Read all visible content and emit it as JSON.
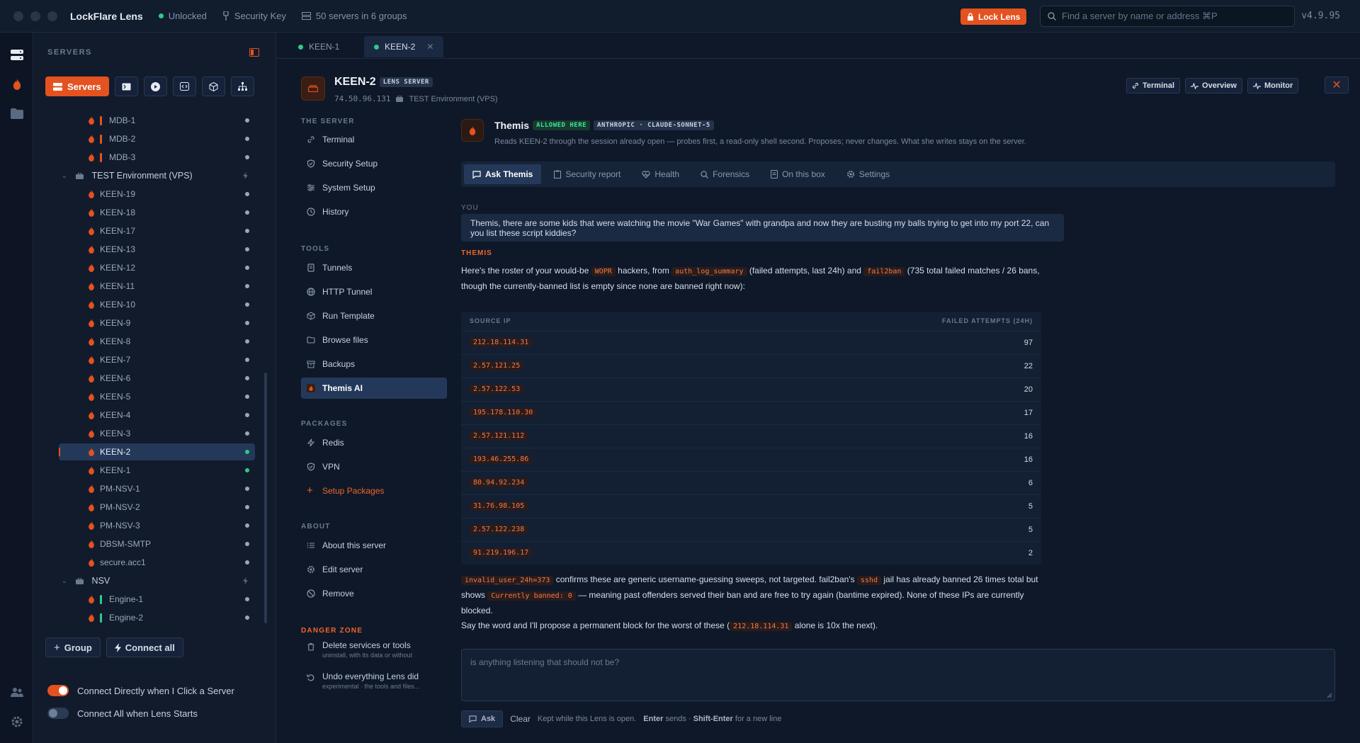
{
  "app": {
    "name": "LockFlare Lens",
    "status": "Unlocked",
    "key_label": "Security Key",
    "servers_summary": "50 servers in 6 groups",
    "lock_label": "Lock Lens",
    "search_placeholder": "Find a server by name or address ⌘P",
    "version": "v4.9.95"
  },
  "sidebar": {
    "heading": "SERVERS",
    "servers_button": "Servers",
    "tree": [
      {
        "name": "MDB-1",
        "kind": "server",
        "bar": "#e4521f"
      },
      {
        "name": "MDB-2",
        "kind": "server",
        "bar": "#e4521f"
      },
      {
        "name": "MDB-3",
        "kind": "server",
        "bar": "#e4521f"
      },
      {
        "name": "TEST Environment (VPS)",
        "kind": "group"
      },
      {
        "name": "KEEN-19",
        "kind": "server"
      },
      {
        "name": "KEEN-18",
        "kind": "server"
      },
      {
        "name": "KEEN-17",
        "kind": "server"
      },
      {
        "name": "KEEN-13",
        "kind": "server"
      },
      {
        "name": "KEEN-12",
        "kind": "server"
      },
      {
        "name": "KEEN-11",
        "kind": "server"
      },
      {
        "name": "KEEN-10",
        "kind": "server"
      },
      {
        "name": "KEEN-9",
        "kind": "server"
      },
      {
        "name": "KEEN-8",
        "kind": "server"
      },
      {
        "name": "KEEN-7",
        "kind": "server"
      },
      {
        "name": "KEEN-6",
        "kind": "server"
      },
      {
        "name": "KEEN-5",
        "kind": "server"
      },
      {
        "name": "KEEN-4",
        "kind": "server"
      },
      {
        "name": "KEEN-3",
        "kind": "server"
      },
      {
        "name": "KEEN-2",
        "kind": "server",
        "selected": true,
        "online": true
      },
      {
        "name": "KEEN-1",
        "kind": "server",
        "online": true
      },
      {
        "name": "PM-NSV-1",
        "kind": "server"
      },
      {
        "name": "PM-NSV-2",
        "kind": "server"
      },
      {
        "name": "PM-NSV-3",
        "kind": "server"
      },
      {
        "name": "DBSM-SMTP",
        "kind": "server"
      },
      {
        "name": "secure.acc1",
        "kind": "server"
      },
      {
        "name": "NSV",
        "kind": "group"
      },
      {
        "name": "Engine-1",
        "kind": "server",
        "bar": "#2fc98b"
      },
      {
        "name": "Engine-2",
        "kind": "server",
        "bar": "#2fc98b"
      }
    ],
    "group_button": "Group",
    "connect_all_button": "Connect all",
    "toggle_connect_click": "Connect Directly when I Click a Server",
    "toggle_connect_start": "Connect All when Lens Starts"
  },
  "tabs": [
    {
      "label": "KEEN-1"
    },
    {
      "label": "KEEN-2"
    }
  ],
  "server": {
    "name": "KEEN-2",
    "badge": "LENS SERVER",
    "ip": "74.50.96.131",
    "group": "TEST Environment (VPS)",
    "actions": {
      "terminal": "Terminal",
      "overview": "Overview",
      "monitor": "Monitor"
    }
  },
  "nav": {
    "h_server": "THE SERVER",
    "terminal": "Terminal",
    "security_setup": "Security Setup",
    "system_setup": "System Setup",
    "history": "History",
    "h_tools": "TOOLS",
    "tunnels": "Tunnels",
    "http_tunnel": "HTTP Tunnel",
    "run_template": "Run Template",
    "browse_files": "Browse files",
    "backups": "Backups",
    "themis_ai": "Themis AI",
    "h_packages": "PACKAGES",
    "redis": "Redis",
    "vpn": "VPN",
    "setup_packages": "Setup Packages",
    "h_about": "ABOUT",
    "about_server": "About this server",
    "edit_server": "Edit server",
    "remove": "Remove",
    "h_danger": "DANGER ZONE",
    "delete_services": "Delete services or tools",
    "delete_desc": "uninstall, with its data or without",
    "undo": "Undo everything Lens did",
    "undo_desc": "experimental · the tools and files..."
  },
  "themis": {
    "name": "Themis",
    "badge_allowed": "ALLOWED HERE",
    "badge_model": "ANTHROPIC · CLAUDE-SONNET-5",
    "description": "Reads KEEN-2 through the session already open — probes first, a read-only shell second. Proposes; never changes. What she writes stays on the server.",
    "tabs": {
      "ask": "Ask Themis",
      "security": "Security report",
      "health": "Health",
      "forensics": "Forensics",
      "onbox": "On this box",
      "settings": "Settings"
    },
    "you_label": "YOU",
    "user_message": "Themis, there are some kids that were watching the movie \"War Games\" with grandpa and now they are busting my balls trying to get into my port 22, can you list these script kiddies?",
    "themis_label": "THEMIS",
    "reply": {
      "p1_a": "Here's the roster of your would-be ",
      "p1_c1": "WOPR",
      "p1_b": " hackers, from ",
      "p1_c2": "auth_log_summary",
      "p1_c": " (failed attempts, last 24h) and ",
      "p1_c3": "fail2ban",
      "p1_d": " (735 total failed matches / 26 bans, though the currently-banned list is empty since none are banned right now):",
      "col_ip": "SOURCE IP",
      "col_count": "FAILED ATTEMPTS (24H)",
      "rows": [
        {
          "ip": "212.18.114.31",
          "count": "97"
        },
        {
          "ip": "2.57.121.25",
          "count": "22"
        },
        {
          "ip": "2.57.122.53",
          "count": "20"
        },
        {
          "ip": "195.178.110.30",
          "count": "17"
        },
        {
          "ip": "2.57.121.112",
          "count": "16"
        },
        {
          "ip": "193.46.255.86",
          "count": "16"
        },
        {
          "ip": "80.94.92.234",
          "count": "6"
        },
        {
          "ip": "31.76.98.105",
          "count": "5"
        },
        {
          "ip": "2.57.122.238",
          "count": "5"
        },
        {
          "ip": "91.219.196.17",
          "count": "2"
        }
      ],
      "p2_c1": "invalid_user_24h=373",
      "p2_a": " confirms these are generic username-guessing sweeps, not targeted. fail2ban's ",
      "p2_c2": "sshd",
      "p2_b": " jail has already banned 26 times total but shows ",
      "p2_c3": "Currently banned: 0",
      "p2_c": " — meaning past offenders served their ban and are free to try again (bantime expired). None of these IPs are currently blocked.",
      "p3_a": "Say the word and I'll propose a permanent block for the worst of these (",
      "p3_c1": "212.18.114.31",
      "p3_b": " alone is 10x the next)."
    },
    "input_placeholder": "is anything listening that should not be?",
    "ask_button": "Ask",
    "clear_button": "Clear",
    "hint_a": "Kept while this Lens is open.",
    "hint_enter": "Enter",
    "hint_b": " sends · ",
    "hint_shift": "Shift-Enter",
    "hint_c": " for a new line"
  },
  "colors": {
    "accent": "#e4521f",
    "online": "#2fc98b",
    "background": "#0f1828"
  }
}
